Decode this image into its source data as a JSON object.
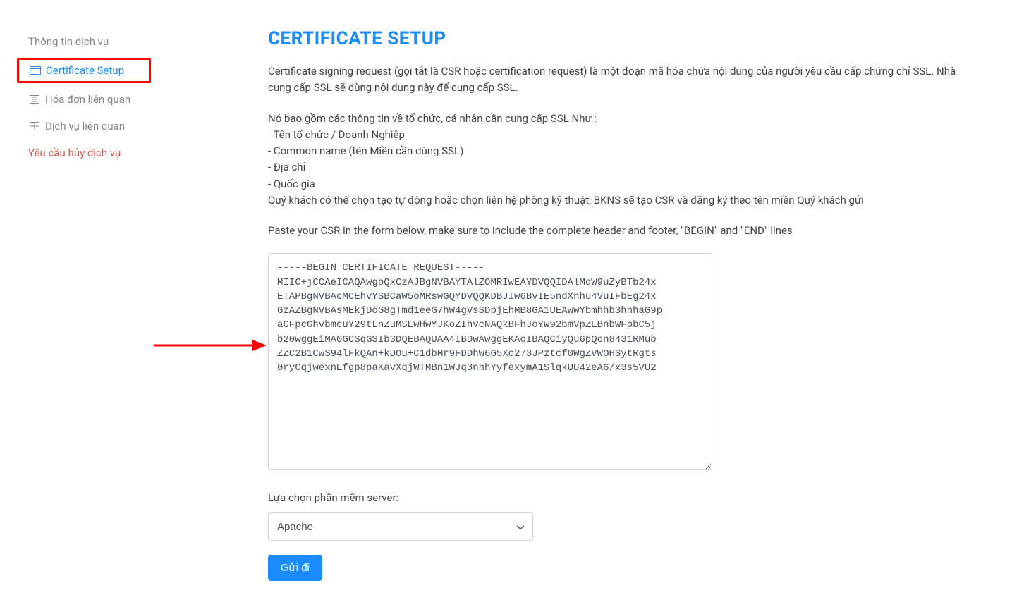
{
  "sidebar": {
    "items": [
      {
        "label": "Thông tin dịch vụ",
        "icon": ""
      },
      {
        "label": "Certificate Setup",
        "icon": "card"
      },
      {
        "label": "Hóa đơn liên quan",
        "icon": "list"
      },
      {
        "label": "Dịch vụ liên quan",
        "icon": "grid"
      },
      {
        "label": "Yêu cầu hủy dịch vụ",
        "icon": ""
      }
    ]
  },
  "page": {
    "title": "CERTIFICATE SETUP",
    "intro1": "Certificate signing request (gọi tắt là CSR hoặc certification request) là một đoạn mã hóa chứa nội dung của người yêu cầu cấp chứng chỉ SSL. Nhà cung cấp SSL sẽ dùng nội dung này để cung cấp SSL.",
    "info_lines": [
      "Nó bao gồm các thông tin về tổ chức, cá nhân cần cung cấp SSL Như :",
      "- Tên tổ chức / Doanh Nghiệp",
      "- Common name (tên Miền cần dùng SSL)",
      "- Địa chỉ",
      "- Quốc gia",
      "Quý khách có thể chọn tạo tự động hoặc chọn liên hệ phòng kỹ thuật, BKNS sẽ tạo CSR và đăng ký theo tên miền Quý khách gửi"
    ],
    "paste_hint": "Paste your CSR in the form below, make sure to include the complete header and footer, \"BEGIN\" and \"END\" lines",
    "csr_value": "-----BEGIN CERTIFICATE REQUEST-----\nMIIC+jCCAeICAQAwgbQxCzAJBgNVBAYTAlZOMRIwEAYDVQQIDAlMdW9uZyBTb24x\nETAPBgNVBAcMCEhvYSBCaW5oMRswGQYDVQQKDBJIw6BvIE5ndXnhu4VuIFbEg24x\nGzAZBgNVBAsMEkjDoG8gTmd1eeG7hW4gVsSDbjEhMB8GA1UEAwwYbmhhb3hhhaG9p\naGFpcGhvbmcuY29tLnZuMSEwHwYJKoZIhvcNAQkBFhJoYW92bmVpZEBnbWFpbC5j\nb20wggEiMA0GCSqGSIb3DQEBAQUAA4IBDwAwggEKAoIBAQCiyQu6pQon8431RMub\nZZC2B1CwS94lFkQAn+kDOu+C1dbMr9FDDhW6G5Xc273JPztcf0WgZVWOHSytRgts\n0ryCqjwexnEfgp8paKavXqjWTMBn1WJq3nhhYyfexymA1SlqkUU42eA6/x3s5VU2\n",
    "server_label": "Lựa chọn phần mềm server:",
    "server_options": [
      "Apache"
    ],
    "server_selected": "Apache",
    "submit_label": "Gửi đi"
  }
}
